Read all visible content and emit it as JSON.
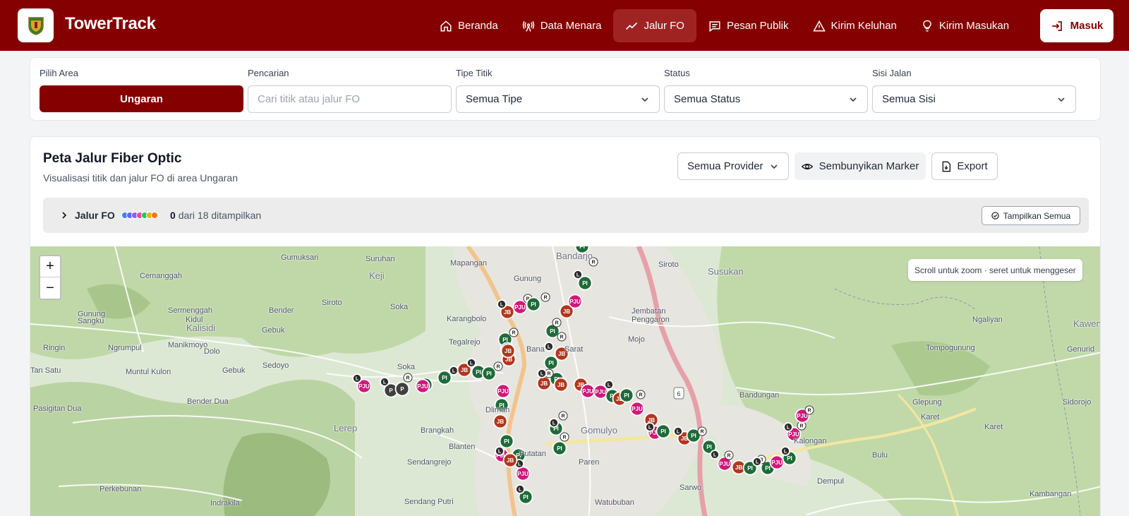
{
  "header": {
    "brand": "TowerTrack",
    "nav": [
      {
        "label": "Beranda",
        "icon": "home-icon"
      },
      {
        "label": "Data Menara",
        "icon": "radio-tower-icon"
      },
      {
        "label": "Jalur FO",
        "icon": "trend-line-icon",
        "active": true
      },
      {
        "label": "Pesan Publik",
        "icon": "message-icon"
      },
      {
        "label": "Kirim Keluhan",
        "icon": "warning-icon"
      },
      {
        "label": "Kirim Masukan",
        "icon": "lightbulb-icon"
      }
    ],
    "login_label": "Masuk",
    "accent": "#850000"
  },
  "filters": {
    "area_label": "Pilih Area",
    "area_value": "Ungaran",
    "search_label": "Pencarian",
    "search_placeholder": "Cari titik atau jalur FO",
    "type_label": "Tipe Titik",
    "type_value": "Semua Tipe",
    "status_label": "Status",
    "status_value": "Semua Status",
    "side_label": "Sisi Jalan",
    "side_value": "Semua Sisi"
  },
  "map_card": {
    "title": "Peta Jalur Fiber Optic",
    "subtitle": "Visualisasi titik dan jalur FO di area Ungaran",
    "provider_value": "Semua Provider",
    "hide_markers_label": "Sembunyikan Marker",
    "export_label": "Export",
    "legend": {
      "label": "Jalur FO",
      "shown": "0",
      "total_text": "dari 18 ditampilkan",
      "show_all_label": "Tampilkan Semua",
      "swatch_colors": [
        "#3b82f6",
        "#6366f1",
        "#8b5cf6",
        "#ec4899",
        "#22c55e",
        "#eab308",
        "#f97316"
      ]
    },
    "map_hint": "Scroll untuk zoom · seret untuk menggeser",
    "zoom_in": "+",
    "zoom_out": "−"
  },
  "map_places": [
    "Cemanggah",
    "Gumuksari",
    "Suruhan",
    "Mapangan",
    "Bandarjo",
    "Siroto",
    "Susukan",
    "Keji",
    "Gunung",
    "Gunung Sangku",
    "Sermenggah Kidul",
    "Bender",
    "Siroto",
    "Soka",
    "Karangbolo",
    "Jembatan Penggaron",
    "Ngaliyan",
    "Kaweng",
    "Kalisidi",
    "Gebuk",
    "Ringin",
    "Ngrumpul",
    "Manikmoyo",
    "Dolo",
    "Tegalrejo",
    "Mojo",
    "Tompogunung",
    "Genurid",
    "Muntul Kulon",
    "Gebuk",
    "Sedoyo",
    "Soka",
    "Bana",
    "Sarat",
    "Bandungan",
    "Glepung",
    "Sidorojo",
    "Bender Dua",
    "Pasigitan Dua",
    "Lerep",
    "Brangkah",
    "Blanten",
    "Putatan",
    "Paren",
    "Gomulyo",
    "Kalongan",
    "Bulu",
    "Karet",
    "Sendangrejo",
    "Perkebunan",
    "Indrakila",
    "Sendang Putri",
    "Watububan",
    "Sarwo",
    "Dempul",
    "Kambangan",
    "Tan Satu",
    "Dliman"
  ],
  "map_markers": [
    {
      "code": "PI",
      "color": "#1f6b3a"
    },
    {
      "code": "PJU",
      "color": "#d1187a"
    },
    {
      "code": "JB",
      "color": "#b3361c"
    },
    {
      "code": "P",
      "color": "#3f3f3f"
    },
    {
      "code": "L",
      "color": "#2b2b2b"
    },
    {
      "code": "R",
      "color": "#ffffff"
    }
  ]
}
